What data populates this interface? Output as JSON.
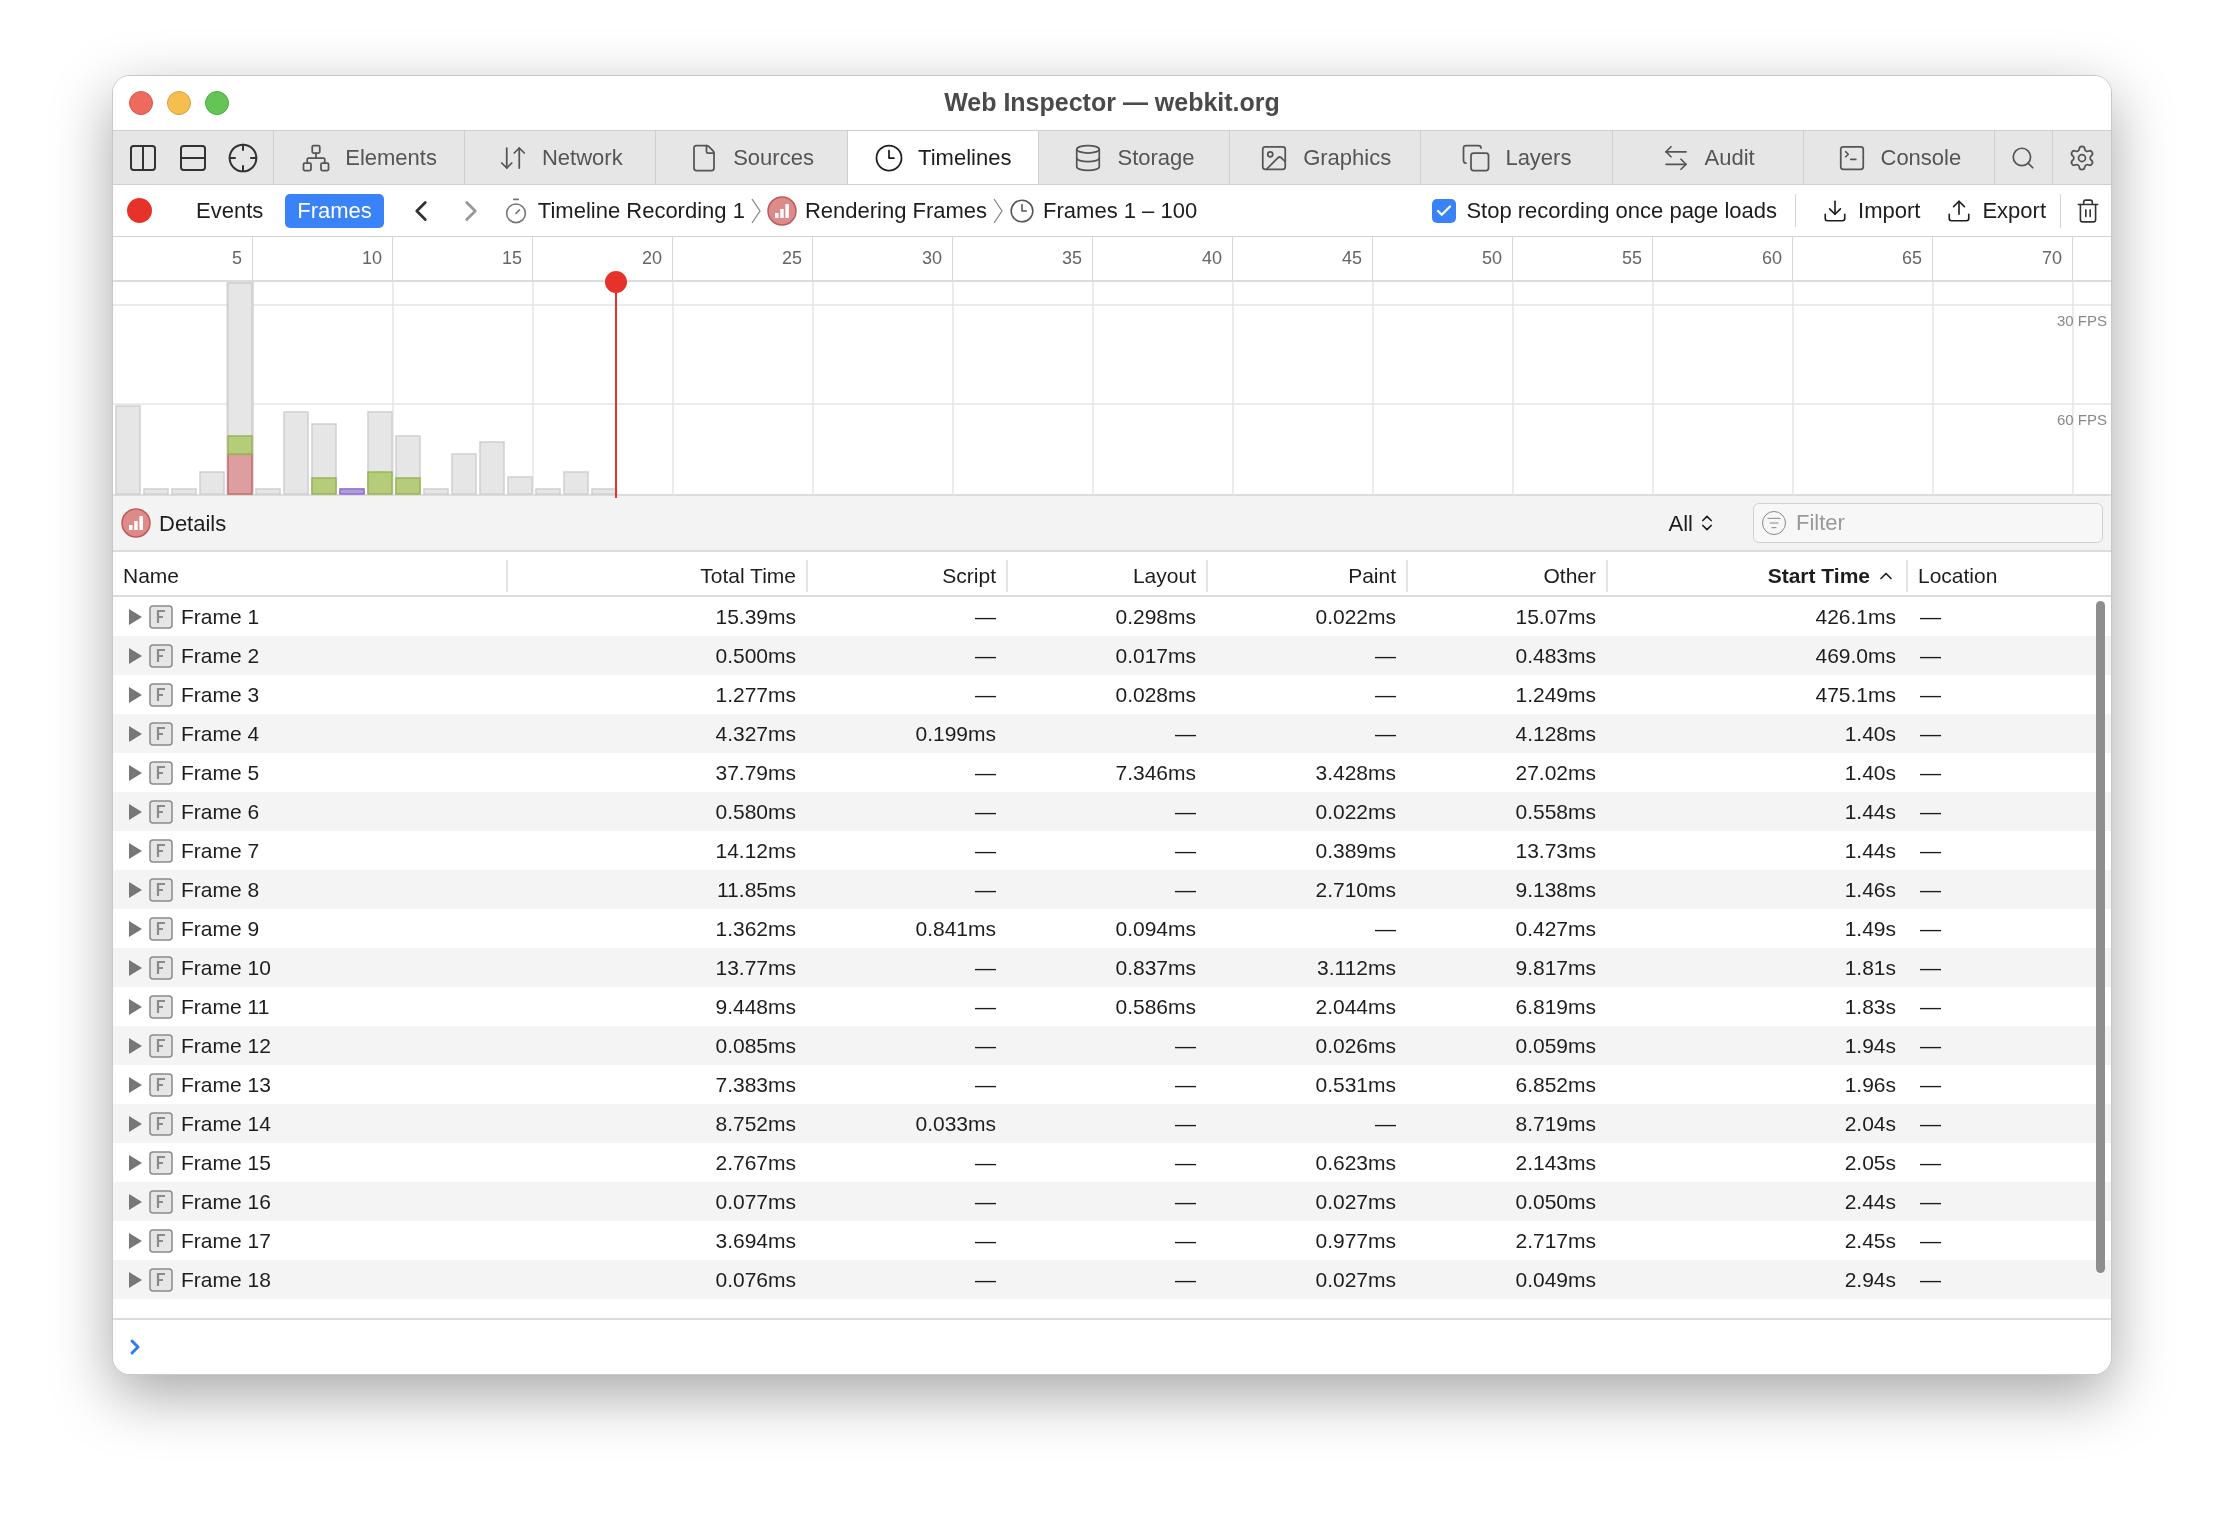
{
  "window": {
    "title": "Web Inspector — webkit.org"
  },
  "tabs": [
    {
      "label": "Elements",
      "selected": false
    },
    {
      "label": "Network",
      "selected": false
    },
    {
      "label": "Sources",
      "selected": false
    },
    {
      "label": "Timelines",
      "selected": true
    },
    {
      "label": "Storage",
      "selected": false
    },
    {
      "label": "Graphics",
      "selected": false
    },
    {
      "label": "Layers",
      "selected": false
    },
    {
      "label": "Audit",
      "selected": false
    },
    {
      "label": "Console",
      "selected": false
    }
  ],
  "toolbar": {
    "view_modes": [
      {
        "label": "Events",
        "selected": false
      },
      {
        "label": "Frames",
        "selected": true
      }
    ],
    "breadcrumbs": [
      "Timeline Recording 1",
      "Rendering Frames",
      "Frames 1 – 100"
    ],
    "stop_option": {
      "label": "Stop recording once page loads",
      "checked": true
    },
    "actions": [
      "Import",
      "Export"
    ]
  },
  "ruler": {
    "ticks": [
      "5",
      "10",
      "15",
      "20",
      "25",
      "30",
      "35",
      "40",
      "45",
      "50",
      "55",
      "60",
      "65",
      "70"
    ]
  },
  "chart": {
    "fps_labels": [
      "30 FPS",
      "60 FPS"
    ]
  },
  "details": {
    "title": "Details",
    "scope": "All",
    "filter": {
      "placeholder": "Filter"
    }
  },
  "table": {
    "columns": [
      {
        "label": "Name",
        "sorted": false
      },
      {
        "label": "Total Time",
        "sorted": false
      },
      {
        "label": "Script",
        "sorted": false
      },
      {
        "label": "Layout",
        "sorted": false
      },
      {
        "label": "Paint",
        "sorted": false
      },
      {
        "label": "Other",
        "sorted": false
      },
      {
        "label": "Start Time",
        "sorted": true
      },
      {
        "label": "Location",
        "sorted": false
      }
    ],
    "rows": [
      {
        "expanded": false,
        "cells": [
          "Frame 1",
          "15.39ms",
          "—",
          "0.298ms",
          "0.022ms",
          "15.07ms",
          "426.1ms",
          "—"
        ]
      },
      {
        "expanded": false,
        "cells": [
          "Frame 2",
          "0.500ms",
          "—",
          "0.017ms",
          "—",
          "0.483ms",
          "469.0ms",
          "—"
        ]
      },
      {
        "expanded": false,
        "cells": [
          "Frame 3",
          "1.277ms",
          "—",
          "0.028ms",
          "—",
          "1.249ms",
          "475.1ms",
          "—"
        ]
      },
      {
        "expanded": false,
        "cells": [
          "Frame 4",
          "4.327ms",
          "0.199ms",
          "—",
          "—",
          "4.128ms",
          "1.40s",
          "—"
        ]
      },
      {
        "expanded": false,
        "cells": [
          "Frame 5",
          "37.79ms",
          "—",
          "7.346ms",
          "3.428ms",
          "27.02ms",
          "1.40s",
          "—"
        ]
      },
      {
        "expanded": false,
        "cells": [
          "Frame 6",
          "0.580ms",
          "—",
          "—",
          "0.022ms",
          "0.558ms",
          "1.44s",
          "—"
        ]
      },
      {
        "expanded": false,
        "cells": [
          "Frame 7",
          "14.12ms",
          "—",
          "—",
          "0.389ms",
          "13.73ms",
          "1.44s",
          "—"
        ]
      },
      {
        "expanded": false,
        "cells": [
          "Frame 8",
          "11.85ms",
          "—",
          "—",
          "2.710ms",
          "9.138ms",
          "1.46s",
          "—"
        ]
      },
      {
        "expanded": false,
        "cells": [
          "Frame 9",
          "1.362ms",
          "0.841ms",
          "0.094ms",
          "—",
          "0.427ms",
          "1.49s",
          "—"
        ]
      },
      {
        "expanded": false,
        "cells": [
          "Frame 10",
          "13.77ms",
          "—",
          "0.837ms",
          "3.112ms",
          "9.817ms",
          "1.81s",
          "—"
        ]
      },
      {
        "expanded": false,
        "cells": [
          "Frame 11",
          "9.448ms",
          "—",
          "0.586ms",
          "2.044ms",
          "6.819ms",
          "1.83s",
          "—"
        ]
      },
      {
        "expanded": false,
        "cells": [
          "Frame 12",
          "0.085ms",
          "—",
          "—",
          "0.026ms",
          "0.059ms",
          "1.94s",
          "—"
        ]
      },
      {
        "expanded": false,
        "cells": [
          "Frame 13",
          "7.383ms",
          "—",
          "—",
          "0.531ms",
          "6.852ms",
          "1.96s",
          "—"
        ]
      },
      {
        "expanded": false,
        "cells": [
          "Frame 14",
          "8.752ms",
          "0.033ms",
          "—",
          "—",
          "8.719ms",
          "2.04s",
          "—"
        ]
      },
      {
        "expanded": false,
        "cells": [
          "Frame 15",
          "2.767ms",
          "—",
          "—",
          "0.623ms",
          "2.143ms",
          "2.05s",
          "—"
        ]
      },
      {
        "expanded": false,
        "cells": [
          "Frame 16",
          "0.077ms",
          "—",
          "—",
          "0.027ms",
          "0.050ms",
          "2.44s",
          "—"
        ]
      },
      {
        "expanded": false,
        "cells": [
          "Frame 17",
          "3.694ms",
          "—",
          "—",
          "0.977ms",
          "2.717ms",
          "2.45s",
          "—"
        ]
      },
      {
        "expanded": false,
        "cells": [
          "Frame 18",
          "0.076ms",
          "—",
          "—",
          "0.027ms",
          "0.049ms",
          "2.94s",
          "—"
        ]
      }
    ]
  }
}
